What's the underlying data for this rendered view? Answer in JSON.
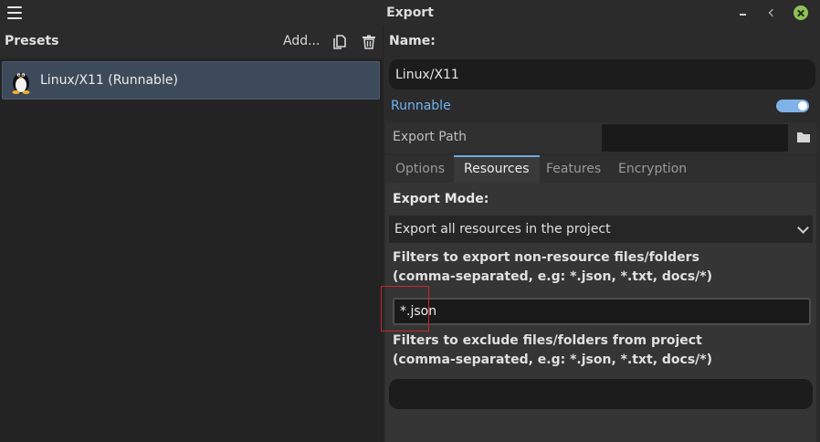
{
  "window": {
    "title": "Export",
    "icons": {
      "menu": "hamburger-icon",
      "minimize": "minimize-icon",
      "maximize": "maximize-icon",
      "close": "close-icon"
    }
  },
  "presets": {
    "label": "Presets",
    "add_label": "Add...",
    "items": [
      {
        "label": "Linux/X11 (Runnable)",
        "icon": "tux-penguin-icon",
        "selected": true
      }
    ]
  },
  "preset_details": {
    "name_label": "Name:",
    "name_value": "Linux/X11",
    "runnable_label": "Runnable",
    "runnable_on": true,
    "export_path_label": "Export Path",
    "export_path_value": "",
    "tabs": [
      {
        "label": "Options",
        "active": false
      },
      {
        "label": "Resources",
        "active": true
      },
      {
        "label": "Features",
        "active": false
      },
      {
        "label": "Encryption",
        "active": false
      }
    ]
  },
  "resources": {
    "export_mode_label": "Export Mode:",
    "export_mode_value": "Export all resources in the project",
    "include_filter_label_1": "Filters to export non-resource files/folders",
    "include_filter_label_2": "(comma-separated, e.g: *.json, *.txt, docs/*)",
    "include_filter_value": "*.json",
    "exclude_filter_label_1": "Filters to exclude files/folders from project",
    "exclude_filter_label_2": "(comma-separated, e.g: *.json, *.txt, docs/*)",
    "exclude_filter_value": ""
  },
  "colors": {
    "accent": "#6fb4f0",
    "toggle": "#7fb2e6",
    "highlight": "#c8262e",
    "close_button": "#8fc15a",
    "selection": "#3d4a5a"
  }
}
